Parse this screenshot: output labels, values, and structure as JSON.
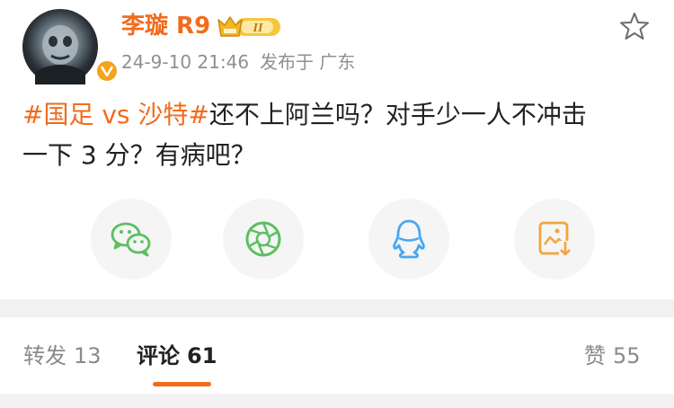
{
  "header": {
    "username": "李璇 R9",
    "level_badge": "II",
    "date": "24-9-10 21:46",
    "source": "发布于 广东"
  },
  "post": {
    "tag1": "#国足 vs 沙特#",
    "line1": "还不上阿兰吗？对手少一人不冲击",
    "line2": "一下 3 分？有病吧？"
  },
  "share_icons": [
    "wechat-icon",
    "moments-icon",
    "qq-icon",
    "save-image-icon"
  ],
  "tabs": {
    "repost_label": "转发",
    "repost_count": "13",
    "comment_label": "评论",
    "comment_count": "61",
    "like_label": "赞",
    "like_count": "55"
  },
  "colors": {
    "accent": "#f26b1d",
    "wechat": "#5cbf5f",
    "qq": "#4aa7ef",
    "save": "#f2a53a",
    "vip_gold": "#f7a21b"
  }
}
